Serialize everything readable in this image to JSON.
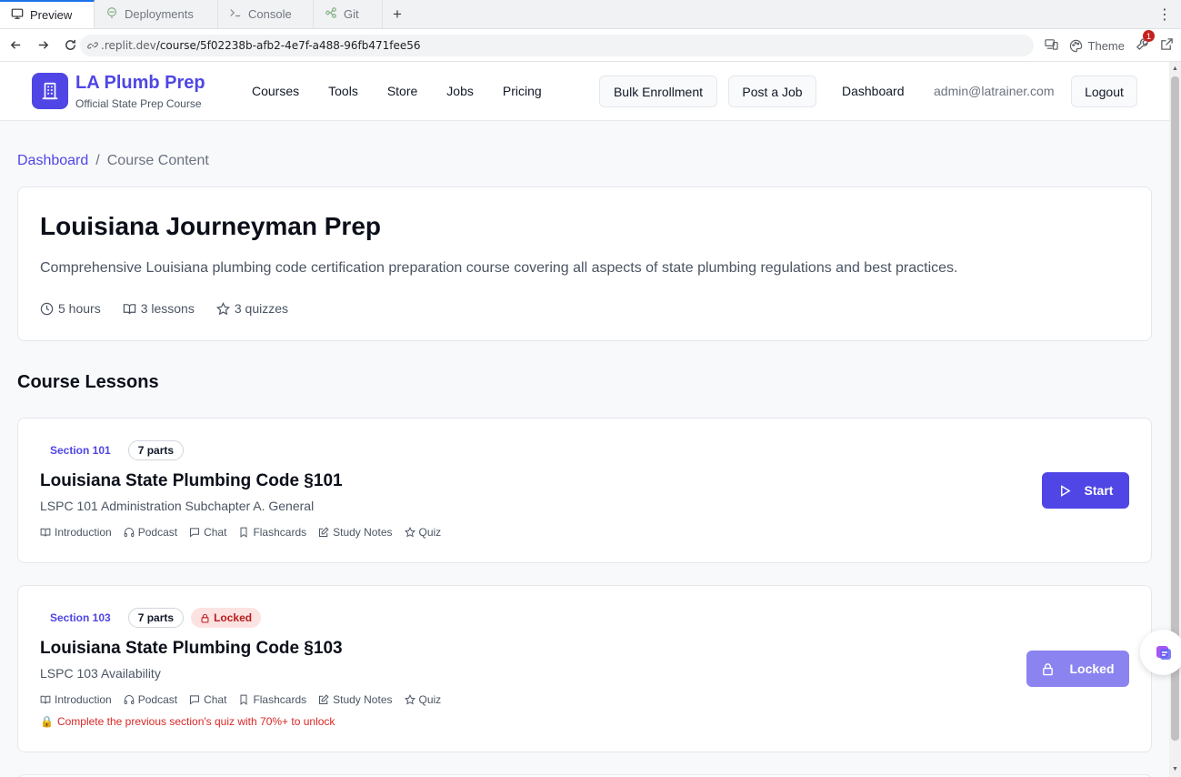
{
  "browser": {
    "tabs": [
      {
        "label": "Preview",
        "active": true,
        "icon": "monitor-icon"
      },
      {
        "label": "Deployments",
        "active": false,
        "icon": "deploy-icon"
      },
      {
        "label": "Console",
        "active": false,
        "icon": "terminal-icon"
      },
      {
        "label": "Git",
        "active": false,
        "icon": "git-icon"
      }
    ],
    "url_host": ".replit.dev",
    "url_path": "/course/5f02238b-afb2-4e7f-a488-96fb471fee56",
    "theme_label": "Theme",
    "notification_count": "1"
  },
  "header": {
    "brand": "LA Plumb Prep",
    "tagline": "Official State Prep Course",
    "nav": [
      "Courses",
      "Tools",
      "Store",
      "Jobs",
      "Pricing"
    ],
    "bulk_enrollment": "Bulk Enrollment",
    "post_job": "Post a Job",
    "dashboard": "Dashboard",
    "user_email": "admin@latrainer.com",
    "logout": "Logout"
  },
  "breadcrumb": {
    "root": "Dashboard",
    "separator": "/",
    "current": "Course Content"
  },
  "course": {
    "title": "Louisiana Journeyman Prep",
    "description": "Comprehensive Louisiana plumbing code certification preparation course covering all aspects of state plumbing regulations and best practices.",
    "duration": "5 hours",
    "lessons": "3 lessons",
    "quizzes": "3 quizzes"
  },
  "lessons_heading": "Course Lessons",
  "lessons": [
    {
      "section": "Section 101",
      "parts": "7 parts",
      "title": "Louisiana State Plumbing Code §101",
      "subtitle": "LSPC 101 Administration Subchapter A. General",
      "features": [
        "Introduction",
        "Podcast",
        "Chat",
        "Flashcards",
        "Study Notes",
        "Quiz"
      ],
      "action": "Start"
    },
    {
      "section": "Section 103",
      "parts": "7 parts",
      "locked_tag": "Locked",
      "title": "Louisiana State Plumbing Code §103",
      "subtitle": "LSPC 103 Availability",
      "features": [
        "Introduction",
        "Podcast",
        "Chat",
        "Flashcards",
        "Study Notes",
        "Quiz"
      ],
      "lock_note": "Complete the previous section's quiz with 70%+ to unlock",
      "action": "Locked"
    }
  ],
  "colors": {
    "primary": "#4f46e5",
    "primary_disabled": "#8b84f0",
    "locked_text": "#b91c1c",
    "locked_bg": "#fde2e2",
    "warning": "#dc2626"
  }
}
